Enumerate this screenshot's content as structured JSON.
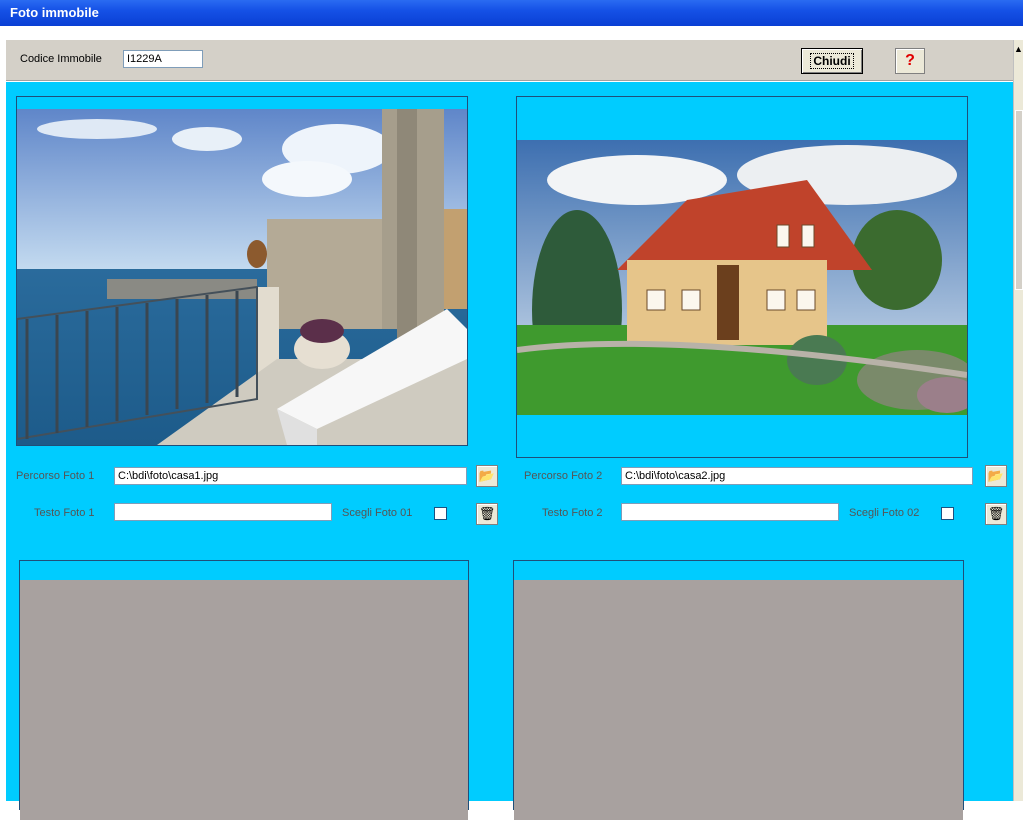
{
  "window": {
    "title": "Foto immobile"
  },
  "toolbar": {
    "code_label": "Codice Immobile",
    "code_value": "I1229A",
    "close_label": "Chiudi",
    "help_label": "?"
  },
  "photos": [
    {
      "path_label": "Percorso Foto 1",
      "path_value": "C:\\bdi\\foto\\casa1.jpg",
      "text_label": "Testo Foto 1",
      "text_value": "",
      "choose_label": "Scegli Foto 01",
      "chosen": false
    },
    {
      "path_label": "Percorso Foto 2",
      "path_value": "C:\\bdi\\foto\\casa2.jpg",
      "text_label": "Testo Foto 2",
      "text_value": "",
      "choose_label": "Scegli Foto 02",
      "chosen": false
    }
  ],
  "icons": {
    "browse": "folder-open-icon",
    "delete": "trash-icon"
  },
  "colors": {
    "canvas": "#00ccff",
    "title_bar": "#0a3fd4",
    "toolbar": "#d4d0c8",
    "empty_photo": "#a8a19f",
    "help": "#e00000"
  }
}
